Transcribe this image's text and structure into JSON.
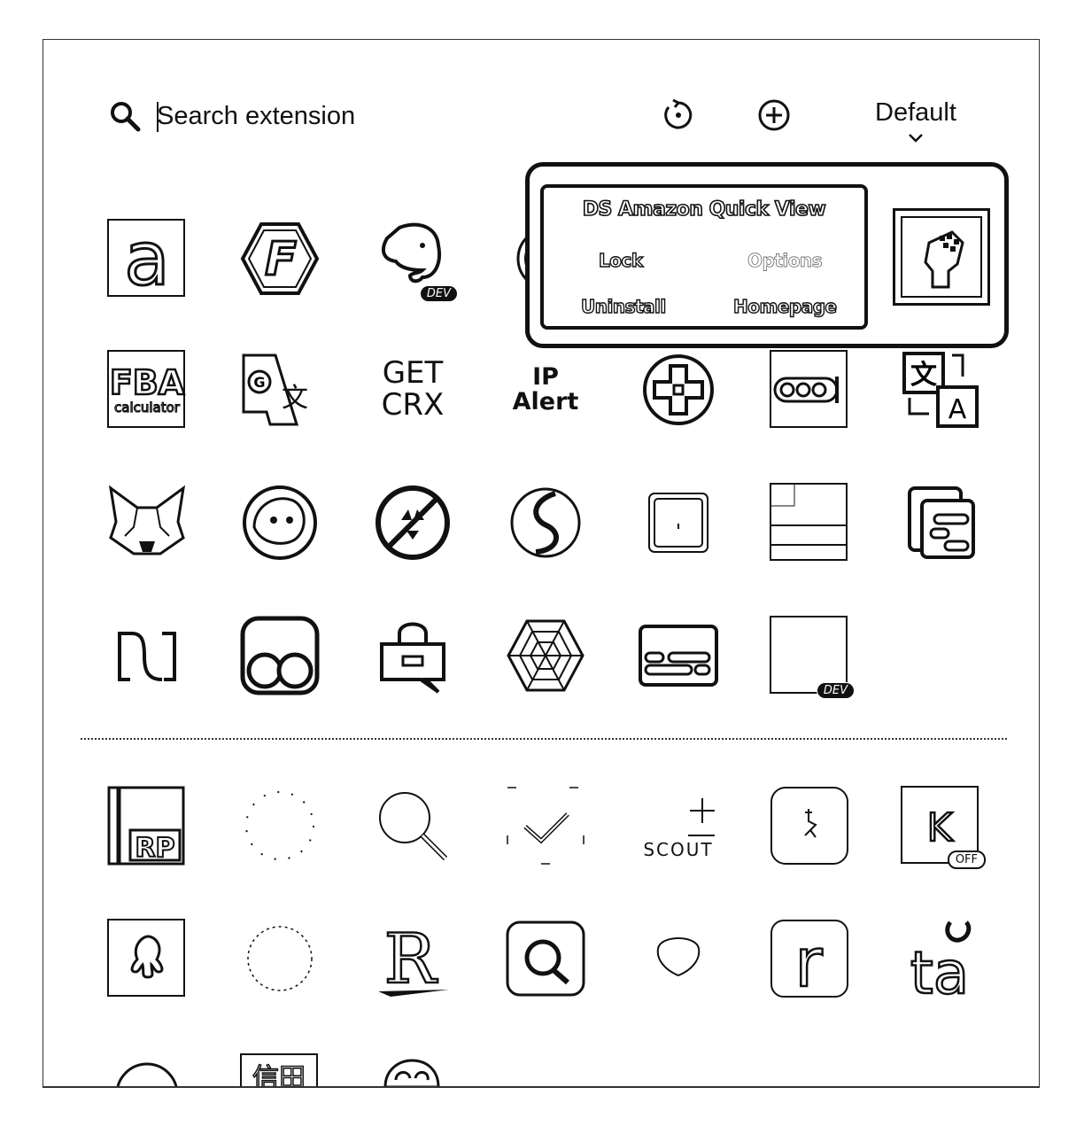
{
  "header": {
    "search_placeholder": "Search extension",
    "profile_select": "Default"
  },
  "icons": {
    "search": "search-icon",
    "refresh": "refresh-icon",
    "add": "plus-circle-icon",
    "chevron": "chevron-down-icon"
  },
  "tiles": {
    "get_crx": [
      "GET",
      "CRX"
    ],
    "ip_alert": [
      "IP",
      "Alert"
    ],
    "fba": [
      "FBA",
      "calculator"
    ],
    "scout": "SCOUT",
    "rp": "RP",
    "amazon": "a",
    "f_hex": "F",
    "k": "K",
    "ta": "ta",
    "r_big": "R",
    "r_small": "r",
    "dev_badge": "DEV",
    "k_badge": "OFF"
  },
  "popup": {
    "title": "DS Amazon Quick View",
    "lock": "Lock",
    "options": "Options",
    "uninstall": "Uninstall",
    "homepage": "Homepage"
  }
}
